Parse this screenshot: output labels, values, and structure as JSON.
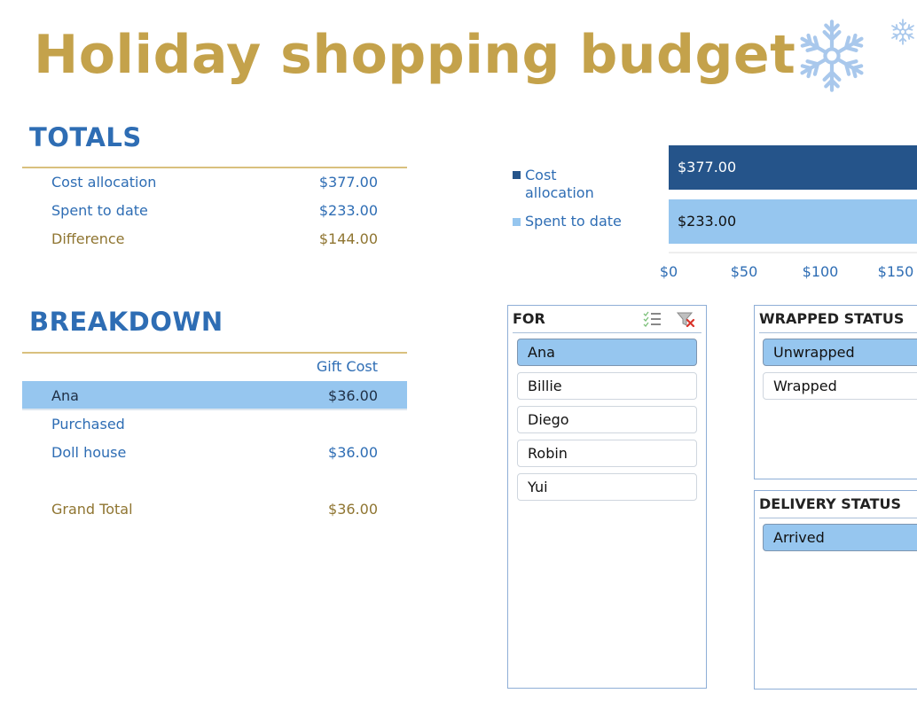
{
  "title": "Holiday shopping budget",
  "decorations": {
    "large_icon": "snowflake-icon",
    "small_icon": "snowflake-icon"
  },
  "colors": {
    "title_gold": "#c4a24b",
    "heading_blue": "#2e6db4",
    "difference_gold": "#8f7531",
    "bar_dark": "#25548a",
    "bar_light": "#96c6ef",
    "selected_fill": "#96c6ef",
    "rule_gold": "#d9c07e"
  },
  "totals": {
    "heading": "TOTALS",
    "rows": [
      {
        "label": "Cost allocation",
        "value": "$377.00"
      },
      {
        "label": "Spent to date",
        "value": "$233.00"
      },
      {
        "label": "Difference",
        "value": "$144.00"
      }
    ]
  },
  "breakdown": {
    "heading": "BREAKDOWN",
    "column_header": "Gift Cost",
    "rows": [
      {
        "label": "Ana",
        "value": "$36.00",
        "style": "group-highlight"
      },
      {
        "label": "Purchased",
        "value": "",
        "style": "subgroup"
      },
      {
        "label": "Doll house",
        "value": "$36.00",
        "style": "item"
      }
    ],
    "grand_total": {
      "label": "Grand Total",
      "value": "$36.00"
    }
  },
  "chart_data": {
    "type": "bar",
    "orientation": "horizontal",
    "title": "",
    "categories": [
      "Cost allocation",
      "Spent to date"
    ],
    "values": [
      377,
      233
    ],
    "data_labels": [
      "$377.00",
      "$233.00"
    ],
    "series": [
      {
        "name": "Cost allocation",
        "values": [
          377
        ],
        "color": "#25548a"
      },
      {
        "name": "Spent to date",
        "values": [
          233
        ],
        "color": "#96c6ef"
      }
    ],
    "x_ticks": [
      "$0",
      "$50",
      "$100",
      "$150"
    ],
    "x_tick_values": [
      0,
      50,
      100,
      150
    ],
    "xlim": [
      0,
      400
    ],
    "xlabel": "",
    "ylabel": "",
    "legend_position": "left",
    "grid": false
  },
  "slicers": {
    "for": {
      "title": "FOR",
      "multi_select_icon": "multi-select-icon",
      "clear_filter_icon": "clear-filter-icon",
      "items": [
        {
          "label": "Ana",
          "selected": true
        },
        {
          "label": "Billie",
          "selected": false
        },
        {
          "label": "Diego",
          "selected": false
        },
        {
          "label": "Robin",
          "selected": false
        },
        {
          "label": "Yui",
          "selected": false
        }
      ]
    },
    "wrapped_status": {
      "title": "WRAPPED STATUS",
      "items": [
        {
          "label": "Unwrapped",
          "selected": true
        },
        {
          "label": "Wrapped",
          "selected": false
        }
      ]
    },
    "delivery_status": {
      "title": "DELIVERY STATUS",
      "items": [
        {
          "label": "Arrived",
          "selected": true
        }
      ]
    }
  }
}
